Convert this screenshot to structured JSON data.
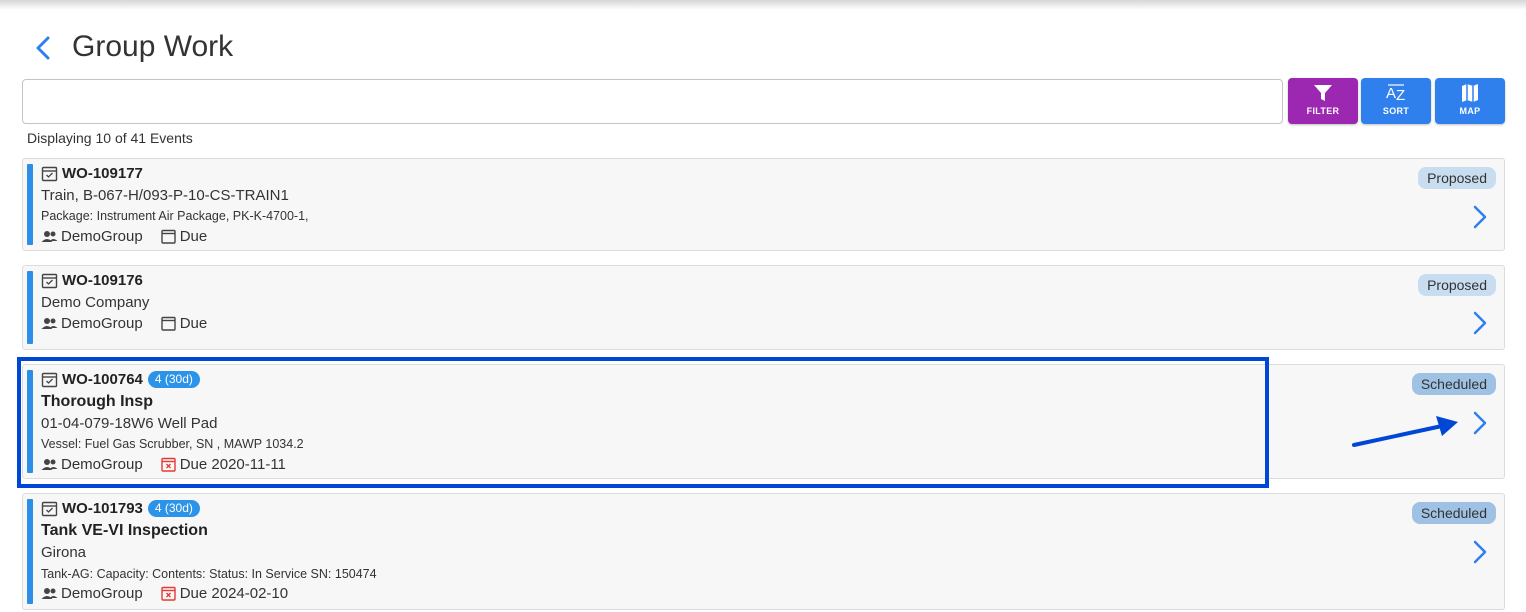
{
  "header": {
    "title": "Group Work",
    "back_icon": "chevron-left-icon"
  },
  "search": {
    "value": "",
    "placeholder": ""
  },
  "toolbar": {
    "filter_label": "FILTER",
    "sort_label": "SORT",
    "sort_icon_text": "AZ",
    "map_label": "MAP",
    "filter_color": "#9c27b0",
    "sort_color": "#2f80ed",
    "map_color": "#2f80ed"
  },
  "list": {
    "count_text": "Displaying 10 of 41 Events"
  },
  "cards": [
    {
      "wo": "WO-109177",
      "title": "",
      "location": "Train, B-067-H/093-P-10-CS-TRAIN1",
      "detail": "Package: Instrument Air Package, PK-K-4700-1,",
      "group": "DemoGroup",
      "due": "Due",
      "status": "Proposed"
    },
    {
      "wo": "WO-109176",
      "title": "",
      "location": "Demo Company",
      "detail": "",
      "group": "DemoGroup",
      "due": "Due",
      "status": "Proposed"
    },
    {
      "wo": "WO-100764",
      "badge": "4 (30d)",
      "title": "Thorough Insp",
      "location": "01-04-079-18W6 Well Pad",
      "detail": "Vessel: Fuel Gas Scrubber, SN , MAWP 1034.2",
      "group": "DemoGroup",
      "due": "Due 2020-11-11",
      "status": "Scheduled",
      "overdue": true
    },
    {
      "wo": "WO-101793",
      "badge": "4 (30d)",
      "title": "Tank VE-VI Inspection",
      "location": "Girona",
      "detail": "Tank-AG: Capacity: Contents: Status: In Service SN: 150474",
      "group": "DemoGroup",
      "due": "Due 2024-02-10",
      "status": "Scheduled",
      "overdue": true
    }
  ],
  "colors": {
    "accent_stripe": "#2d8ee8",
    "annotation": "#0047d6",
    "overdue_icon": "#e53935"
  }
}
